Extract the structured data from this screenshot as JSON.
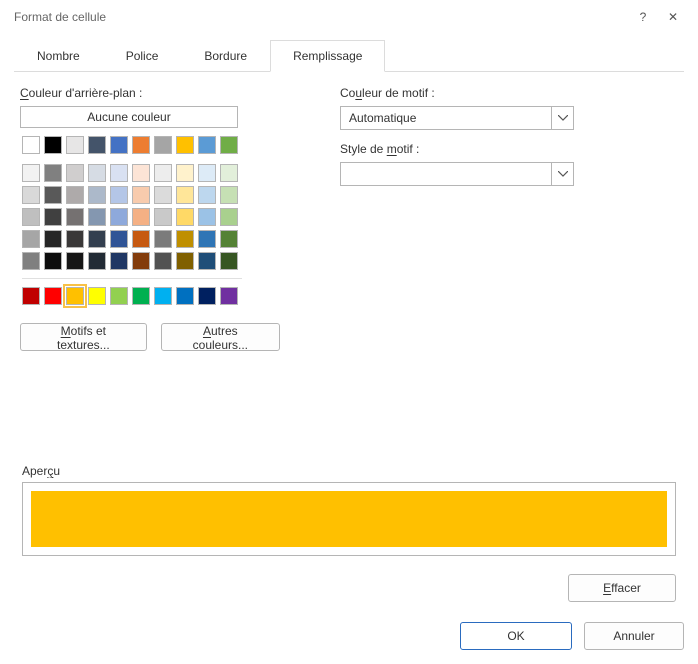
{
  "window": {
    "title": "Format de cellule",
    "help": "?",
    "close": "✕"
  },
  "tabs": [
    "Nombre",
    "Police",
    "Bordure",
    "Remplissage"
  ],
  "active_tab": 3,
  "bgcolor": {
    "label": "Couleur d'arrière-plan :",
    "no_color": "Aucune couleur",
    "theme_row": [
      "#ffffff",
      "#000000",
      "#e7e6e6",
      "#44546a",
      "#4472c4",
      "#ed7d31",
      "#a5a5a5",
      "#ffc000",
      "#5b9bd5",
      "#70ad47"
    ],
    "shades": [
      [
        "#f2f2f2",
        "#808080",
        "#d0cece",
        "#d6dce4",
        "#d9e1f2",
        "#fce4d6",
        "#ededed",
        "#fff2cc",
        "#ddebf7",
        "#e2efda"
      ],
      [
        "#d9d9d9",
        "#595959",
        "#aeaaaa",
        "#acb9ca",
        "#b4c6e7",
        "#f8cbad",
        "#dbdbdb",
        "#ffe699",
        "#bdd7ee",
        "#c6e0b4"
      ],
      [
        "#bfbfbf",
        "#404040",
        "#757171",
        "#8497b0",
        "#8ea9db",
        "#f4b084",
        "#c9c9c9",
        "#ffd966",
        "#9bc2e6",
        "#a9d08e"
      ],
      [
        "#a6a6a6",
        "#262626",
        "#3a3838",
        "#333f4f",
        "#305496",
        "#c65911",
        "#7b7b7b",
        "#bf8f00",
        "#2f75b5",
        "#548235"
      ],
      [
        "#808080",
        "#0d0d0d",
        "#161616",
        "#222b35",
        "#203764",
        "#833c0c",
        "#525252",
        "#806000",
        "#1f4e78",
        "#375623"
      ]
    ],
    "standard": [
      "#c00000",
      "#ff0000",
      "#ffc000",
      "#ffff00",
      "#92d050",
      "#00b050",
      "#00b0f0",
      "#0070c0",
      "#002060",
      "#7030a0"
    ],
    "selected": "#ffc000"
  },
  "buttons": {
    "fill_effects": "Motifs et textures...",
    "more_colors": "Autres couleurs..."
  },
  "pattern": {
    "color_label": "Couleur de motif :",
    "color_value": "Automatique",
    "style_label": "Style de motif :",
    "style_value": ""
  },
  "preview": {
    "label": "Aperçu",
    "color": "#ffc000"
  },
  "clear": "Effacer",
  "footer": {
    "ok": "OK",
    "cancel": "Annuler"
  }
}
